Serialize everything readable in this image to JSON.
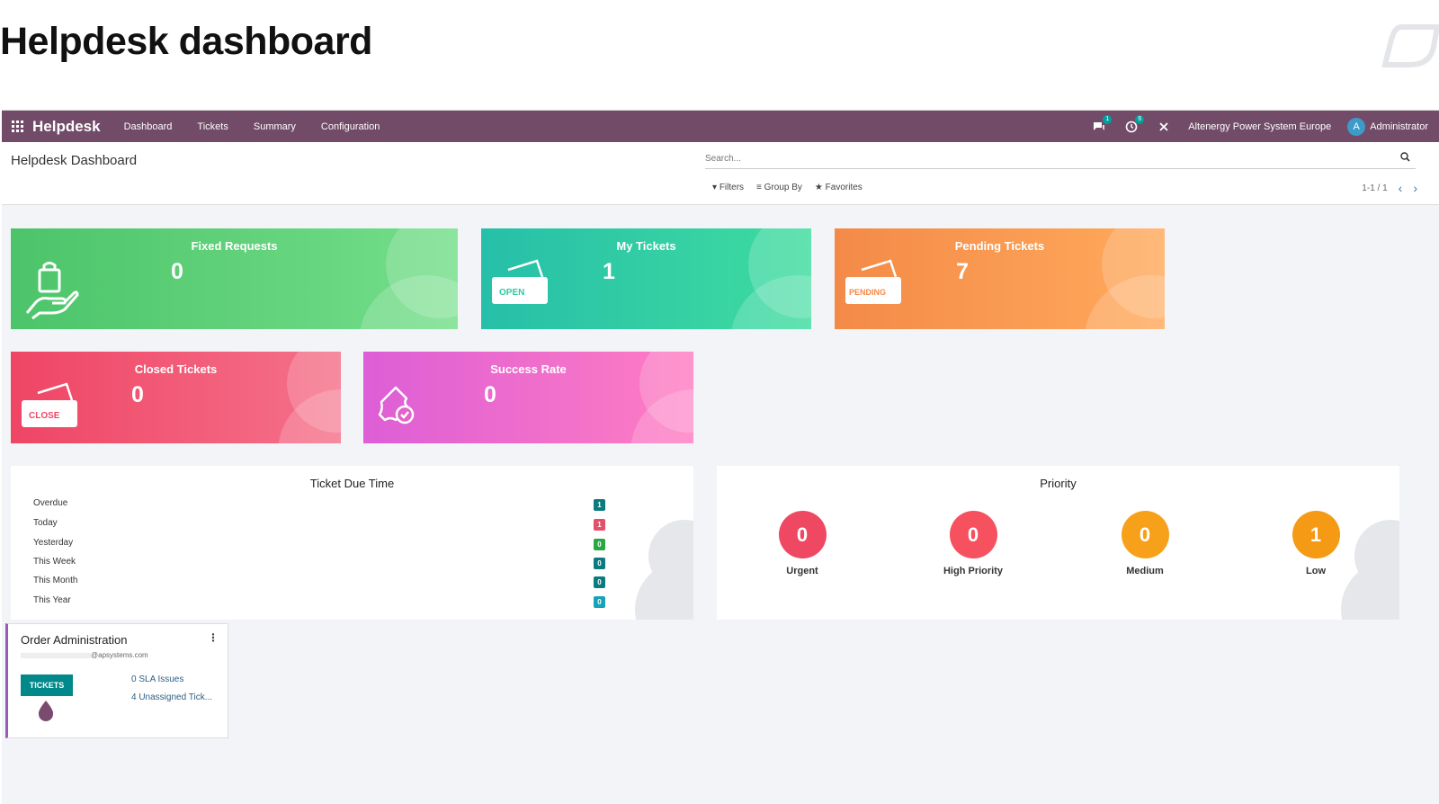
{
  "heading": "Helpdesk dashboard",
  "navbar": {
    "brand": "Helpdesk",
    "menu": [
      "Dashboard",
      "Tickets",
      "Summary",
      "Configuration"
    ],
    "messages_badge": "1",
    "activities_badge": "6",
    "company": "Altenergy Power System Europe",
    "avatar_letter": "A",
    "user": "Administrator"
  },
  "control_panel": {
    "title": "Helpdesk Dashboard",
    "search_placeholder": "Search...",
    "filters": "Filters",
    "group_by": "Group By",
    "favorites": "Favorites",
    "pager": "1-1 / 1"
  },
  "tiles": {
    "fixed": {
      "title": "Fixed Requests",
      "value": "0",
      "color_start": "#4cc46a",
      "color_end": "#74de8a"
    },
    "my": {
      "title": "My Tickets",
      "value": "1",
      "color_start": "#26bfa9",
      "color_end": "#3fdc9f",
      "icon_text": "OPEN"
    },
    "pending": {
      "title": "Pending Tickets",
      "value": "7",
      "color_start": "#f48a48",
      "color_end": "#ffaa5c",
      "icon_text": "PENDING"
    },
    "closed": {
      "title": "Closed Tickets",
      "value": "0",
      "color_start": "#ef4565",
      "color_end": "#f5718a",
      "icon_text": "CLOSE"
    },
    "success": {
      "title": "Success Rate",
      "value": "0",
      "color_start": "#dd5ed6",
      "color_end": "#ff7dc2"
    }
  },
  "due_time": {
    "title": "Ticket Due Time",
    "rows": [
      {
        "label": "Overdue",
        "count": "1",
        "color": "#0b7b80"
      },
      {
        "label": "Today",
        "count": "1",
        "color": "#e2506a"
      },
      {
        "label": "Yesterday",
        "count": "0",
        "color": "#28a745"
      },
      {
        "label": "This Week",
        "count": "0",
        "color": "#0b7b80"
      },
      {
        "label": "This Month",
        "count": "0",
        "color": "#0b7b80"
      },
      {
        "label": "This Year",
        "count": "0",
        "color": "#17a2b8"
      }
    ]
  },
  "priority": {
    "title": "Priority",
    "items": [
      {
        "label": "Urgent",
        "value": "0",
        "color": "#ee4862"
      },
      {
        "label": "High Priority",
        "value": "0",
        "color": "#f5515f"
      },
      {
        "label": "Medium",
        "value": "0",
        "color": "#f7a11a"
      },
      {
        "label": "Low",
        "value": "1",
        "color": "#f59a14"
      }
    ]
  },
  "kanban": {
    "title": "Order Administration",
    "email_domain": "@apsystems.com",
    "button": "TICKETS",
    "sla": "0 SLA Issues",
    "unassigned": "4 Unassigned Tick..."
  }
}
